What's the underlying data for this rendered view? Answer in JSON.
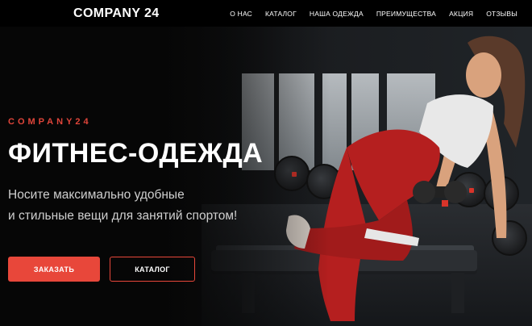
{
  "header": {
    "logo": "COMPANY 24",
    "nav": [
      {
        "label": "О НАС"
      },
      {
        "label": "КАТАЛОГ"
      },
      {
        "label": "НАША ОДЕЖДА"
      },
      {
        "label": "ПРЕИМУЩЕСТВА"
      },
      {
        "label": "АКЦИЯ"
      },
      {
        "label": "ОТЗЫВЫ"
      }
    ]
  },
  "hero": {
    "kicker": "COMPANY24",
    "title": "ФИТНЕС-ОДЕЖДА",
    "subtitle_line1": "Носите максимально удобные",
    "subtitle_line2": "и стильные вещи для занятий спортом!",
    "order_button": "ЗАКАЗАТЬ",
    "catalog_button": "КАТАЛОГ"
  },
  "colors": {
    "accent": "#e8473a",
    "header_bg": "#000000",
    "leggings": "#b51f1f"
  }
}
